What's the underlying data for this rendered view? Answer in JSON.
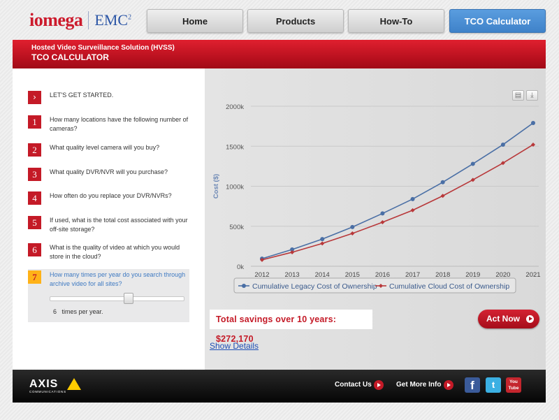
{
  "brand": {
    "iomega": "iomega",
    "emc": "EMC",
    "emc_sup": "2"
  },
  "nav": {
    "home": "Home",
    "products": "Products",
    "howto": "How-To",
    "tco": "TCO Calculator"
  },
  "banner": {
    "subtitle": "Hosted Video Surveillance Solution (HVSS)",
    "title": "TCO CALCULATOR"
  },
  "steps": {
    "start": {
      "marker": "›",
      "text": "LET'S GET STARTED."
    },
    "items": [
      {
        "num": "1",
        "text": "How many locations have the following number of cameras?"
      },
      {
        "num": "2",
        "text": "What quality level camera will you buy?"
      },
      {
        "num": "3",
        "text": "What quality DVR/NVR will you purchase?"
      },
      {
        "num": "4",
        "text": "How often do you replace your DVR/NVRs?"
      },
      {
        "num": "5",
        "text": "If used, what is the total cost associated with your off-site storage?"
      },
      {
        "num": "6",
        "text": "What is the quality of video at which you would store in the cloud?"
      },
      {
        "num": "7",
        "text": "How many times per year do you search through archive video for all sites?"
      }
    ]
  },
  "slider": {
    "value": "6",
    "unit": "times per year.",
    "fraction": 0.55
  },
  "chart_data": {
    "type": "line",
    "ylabel": "Cost ($)",
    "x": [
      "2012",
      "2013",
      "2014",
      "2015",
      "2016",
      "2017",
      "2018",
      "2019",
      "2020",
      "2021"
    ],
    "ylim": [
      0,
      2000000
    ],
    "yticks": [
      0,
      500000,
      1000000,
      1500000,
      2000000
    ],
    "ytick_labels": [
      "0k",
      "500k",
      "1000k",
      "1500k",
      "2000k"
    ],
    "series": [
      {
        "name": "Cumulative Legacy Cost of Ownership",
        "color": "#4a6fa5",
        "values": [
          95000,
          210000,
          340000,
          490000,
          660000,
          840000,
          1050000,
          1280000,
          1520000,
          1790000
        ]
      },
      {
        "name": "Cumulative Cloud Cost of Ownership",
        "color": "#b8383a",
        "values": [
          80000,
          175000,
          285000,
          410000,
          550000,
          700000,
          880000,
          1080000,
          1290000,
          1520000
        ]
      }
    ],
    "legend": "bottom"
  },
  "savings": {
    "text": "Total savings over 10 years: $272,170"
  },
  "act_now": "Act Now",
  "show_details": "Show Details",
  "footer": {
    "axis": "AXIS",
    "axis_sub": "COMMUNICATIONS",
    "contact": "Contact Us",
    "more_info": "Get More Info",
    "facebook": "f",
    "twitter": "t",
    "youtube_top": "You",
    "youtube_bottom": "Tube"
  }
}
